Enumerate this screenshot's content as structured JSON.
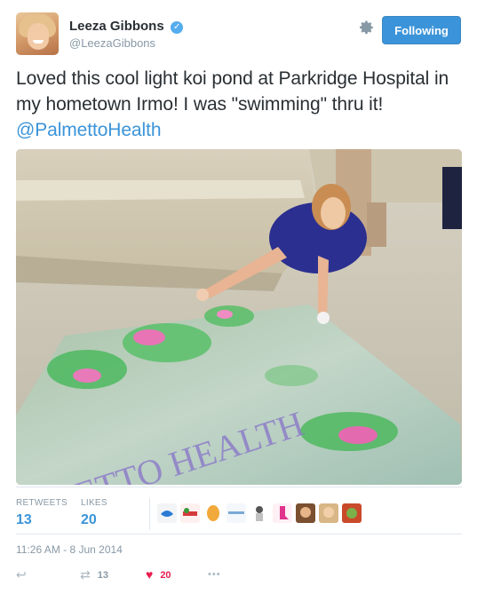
{
  "user": {
    "display_name": "Leeza Gibbons",
    "handle": "@LeezaGibbons",
    "verified_icon": "✓",
    "follow_label": "Following"
  },
  "tweet": {
    "text": "Loved this cool light koi pond at  Parkridge Hospital in my hometown Irmo! I was \"swimming\" thru it! ",
    "mention": "@PalmettoHealth"
  },
  "photo": {
    "alt_text_overlay": "METTO HEALTH"
  },
  "stats": {
    "retweets_label": "RETWEETS",
    "retweets_count": "13",
    "likes_label": "LIKES",
    "likes_count": "20"
  },
  "timestamp": "11:26 AM - 8 Jun 2014",
  "actions": {
    "reply_icon": "↩",
    "retweet_icon": "⇄",
    "retweet_count": "13",
    "like_icon": "♥",
    "like_count": "20",
    "more_icon": "•••"
  },
  "colors": {
    "accent": "#3b94d9",
    "like": "#e81c4f",
    "muted": "#8899a6"
  }
}
